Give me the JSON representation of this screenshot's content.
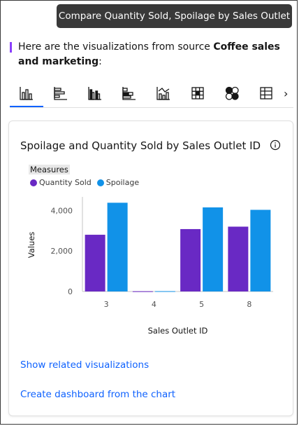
{
  "tooltip": {
    "text": "Compare Quantity Sold, Spoilage by Sales Outlet ID"
  },
  "intro": {
    "prefix": "Here are the visualizations from source ",
    "source": "Coffee sales and marketing",
    "suffix": ":"
  },
  "tabs": [
    {
      "icon": "bar-chart-icon",
      "active": true
    },
    {
      "icon": "horizontal-bar-icon",
      "active": false
    },
    {
      "icon": "grouped-bar-icon",
      "active": false
    },
    {
      "icon": "stacked-horizontal-bar-icon",
      "active": false
    },
    {
      "icon": "line-bar-combo-icon",
      "active": false
    },
    {
      "icon": "heatmap-grid-icon",
      "active": false
    },
    {
      "icon": "bubble-icon",
      "active": false
    },
    {
      "icon": "table-icon",
      "active": false
    }
  ],
  "card": {
    "title": "Spoilage and Quantity Sold by Sales Outlet ID",
    "legend_title": "Measures",
    "links": {
      "related": "Show related visualizations",
      "dashboard": "Create dashboard from the chart"
    }
  },
  "chart_data": {
    "type": "bar",
    "title": "Spoilage and Quantity Sold by Sales Outlet ID",
    "xlabel": "Sales Outlet ID",
    "ylabel": "Values",
    "categories": [
      "3",
      "4",
      "5",
      "8"
    ],
    "series": [
      {
        "name": "Quantity Sold",
        "color": "#6929c4",
        "values": [
          2800,
          10,
          3080,
          3200
        ]
      },
      {
        "name": "Spoilage",
        "color": "#1192e8",
        "values": [
          4380,
          15,
          4150,
          4030
        ]
      }
    ],
    "yticks": [
      0,
      2000,
      4000
    ],
    "ytick_labels": [
      "0",
      "2,000",
      "4,000"
    ],
    "ylim": [
      0,
      4600
    ],
    "legend_position": "top-left",
    "grid": false
  }
}
